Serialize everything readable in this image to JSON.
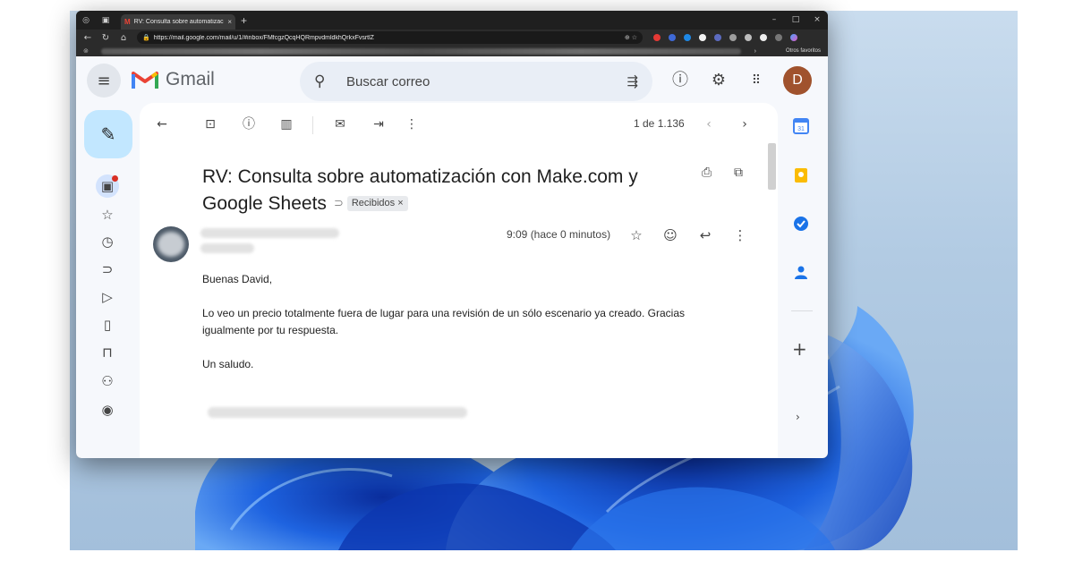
{
  "browser": {
    "tab_title": "RV: Consulta sobre automatizació",
    "url": "https://mail.google.com/mail/u/1/#inbox/FMfcgzQcqHQRmpvdmldkhQrkxFvsrtlZ",
    "favorites_label": "Otros favoritos"
  },
  "gmail": {
    "wordmark": "Gmail",
    "search_placeholder": "Buscar correo",
    "avatar_letter": "D",
    "pager": "1 de 1.136",
    "subject": "RV: Consulta sobre automatización con Make.com y Google Sheets",
    "label": "Recibidos ×",
    "time": "9:09 (hace 0 minutos)",
    "body": [
      "Buenas David,",
      "Lo veo un precio totalmente fuera de lugar para una revisión de un sólo escenario ya creado. Gracias igualmente por tu respuesta.",
      "Un saludo."
    ]
  },
  "icons": {
    "menu": "≡",
    "search": "⚲",
    "tune": "⇶",
    "help": "?",
    "settings": "⚙",
    "apps": "⋮⋮⋮",
    "compose": "✎",
    "back": "←",
    "archive": "⊡",
    "report": "ⓘ",
    "delete": "🗑",
    "unread": "✉",
    "move": "⇥",
    "more": "⋮",
    "prev": "‹",
    "next": "›",
    "print": "⎙",
    "newwin": "⧉",
    "star": "☆",
    "emoji": "☺",
    "reply": "↩"
  },
  "colors": {
    "gmail_red": "#ea4335",
    "compose_bg": "#c2e7ff",
    "avatar_bg": "#a0522d",
    "unread_dot": "#d93025"
  }
}
